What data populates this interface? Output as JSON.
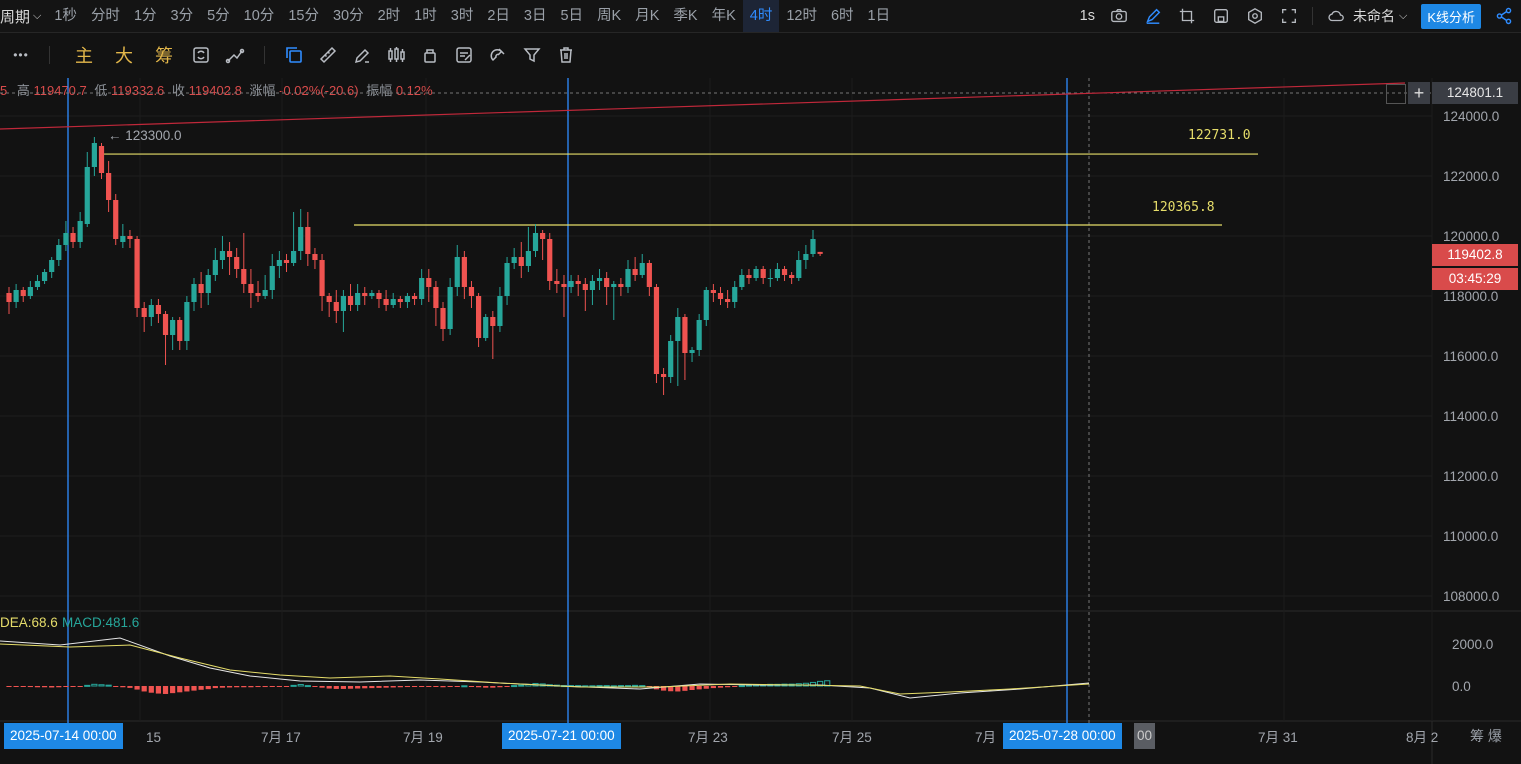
{
  "toolbar": {
    "period_label": "周期",
    "timeframes": [
      "1秒",
      "分时",
      "1分",
      "3分",
      "5分",
      "10分",
      "15分",
      "30分",
      "2时",
      "1时",
      "3时",
      "2日",
      "3日",
      "5日",
      "周K",
      "月K",
      "季K",
      "年K",
      "4时",
      "12时",
      "6时",
      "1日"
    ],
    "active_timeframe": "4时",
    "speed": "1s",
    "layout_name": "未命名",
    "kline_button": "K线分析"
  },
  "drawing_tools": {
    "more": "•••",
    "main_label": "主",
    "big_label": "大",
    "chip_label": "筹"
  },
  "ohlc": {
    "prefix": "5",
    "high_label": "高",
    "high": "119470.7",
    "low_label": "低",
    "low": "119332.6",
    "close_label": "收",
    "close": "119402.8",
    "change_label": "涨幅",
    "change": "-0.02%(-20.6)",
    "amp_label": "振幅",
    "amp": "0.12%"
  },
  "price_axis": {
    "ticks": [
      "124000.0",
      "122000.0",
      "120000.0",
      "118000.0",
      "116000.0",
      "114000.0",
      "112000.0",
      "110000.0",
      "108000.0"
    ],
    "crosshair_price": "124801.1",
    "last_price": "119402.8",
    "countdown": "03:45:29"
  },
  "macd_axis": {
    "ticks": [
      "2000.0",
      "0.0"
    ]
  },
  "macd_legend": {
    "dea": "DEA:68.6",
    "macd": "MACD:481.6"
  },
  "annotations": {
    "high_marker": "← 123300.0",
    "line1": "122731.0",
    "line2": "120365.8"
  },
  "date_axis": {
    "labels": [
      "15",
      "7月 17",
      "7月 19",
      "7月 23",
      "7月 25",
      "7月 31",
      "8月 2"
    ],
    "highlight_boxes": [
      "2025-07-14 00:00",
      "2025-07-21 00:00",
      "2025-07-28 00:00"
    ],
    "partial": "7月",
    "partial2": "00"
  },
  "bottom_right": "筹  爆",
  "colors": {
    "up": "#26a69a",
    "down": "#ef5350",
    "accent": "#2f8cff",
    "level": "#e6dd6a"
  },
  "chart_data": {
    "type": "candlestick",
    "ylim": [
      107000,
      125300
    ],
    "candles": [
      [
        118100,
        117800,
        118300,
        117400
      ],
      [
        117800,
        118200,
        118400,
        117600
      ],
      [
        118200,
        118000,
        118300,
        117800
      ],
      [
        118000,
        118300,
        118500,
        117900
      ],
      [
        118300,
        118500,
        118700,
        118200
      ],
      [
        118500,
        118800,
        118900,
        118400
      ],
      [
        118800,
        119200,
        119300,
        118600
      ],
      [
        119200,
        119700,
        119900,
        119000
      ],
      [
        119700,
        120100,
        120500,
        119500
      ],
      [
        120100,
        119800,
        120300,
        119600
      ],
      [
        119800,
        120500,
        120800,
        119600
      ],
      [
        120400,
        122300,
        122800,
        120300
      ],
      [
        122300,
        123100,
        123300,
        122000
      ],
      [
        123000,
        122100,
        123100,
        121900
      ],
      [
        122100,
        121200,
        122500,
        120800
      ],
      [
        121200,
        119900,
        121400,
        119700
      ],
      [
        119800,
        120000,
        120400,
        119600
      ],
      [
        120000,
        119900,
        120200,
        119600
      ],
      [
        119900,
        117600,
        120000,
        117300
      ],
      [
        117600,
        117300,
        117800,
        116800
      ],
      [
        117300,
        117700,
        117900,
        117000
      ],
      [
        117700,
        117400,
        117900,
        117100
      ],
      [
        117400,
        116700,
        117500,
        115700
      ],
      [
        116700,
        117200,
        117300,
        116200
      ],
      [
        117200,
        116500,
        117300,
        116200
      ],
      [
        116500,
        117800,
        118000,
        116200
      ],
      [
        117800,
        118400,
        118600,
        117500
      ],
      [
        118400,
        118100,
        118800,
        117600
      ],
      [
        118100,
        118700,
        118900,
        117700
      ],
      [
        118700,
        119200,
        119600,
        118500
      ],
      [
        119200,
        119500,
        120000,
        118900
      ],
      [
        119500,
        119300,
        119800,
        118700
      ],
      [
        119300,
        118900,
        119600,
        118600
      ],
      [
        118900,
        118400,
        120100,
        118100
      ],
      [
        118400,
        118100,
        118900,
        117600
      ],
      [
        118100,
        118000,
        118500,
        117800
      ],
      [
        118000,
        118200,
        118700,
        117900
      ],
      [
        118200,
        119000,
        119400,
        117900
      ],
      [
        119000,
        119200,
        119500,
        118600
      ],
      [
        119200,
        119100,
        119400,
        118800
      ],
      [
        119100,
        119500,
        120800,
        119000
      ],
      [
        119500,
        120300,
        120900,
        119200
      ],
      [
        120300,
        119400,
        120800,
        119000
      ],
      [
        119400,
        119200,
        119600,
        118900
      ],
      [
        119200,
        118000,
        119400,
        117500
      ],
      [
        118000,
        117800,
        118100,
        117300
      ],
      [
        117800,
        117500,
        118200,
        117100
      ],
      [
        117500,
        118000,
        118200,
        116800
      ],
      [
        118000,
        117700,
        118400,
        117500
      ],
      [
        117700,
        118100,
        118400,
        117500
      ],
      [
        118100,
        118000,
        118300,
        117700
      ],
      [
        118000,
        118100,
        118200,
        117900
      ],
      [
        118100,
        117900,
        118200,
        117600
      ],
      [
        117900,
        117700,
        118200,
        117500
      ],
      [
        117700,
        117900,
        118100,
        117600
      ],
      [
        117900,
        117800,
        118000,
        117600
      ],
      [
        117800,
        118000,
        118100,
        117600
      ],
      [
        118000,
        117900,
        118100,
        117700
      ],
      [
        117900,
        118600,
        118900,
        117700
      ],
      [
        118600,
        118300,
        118900,
        117800
      ],
      [
        118300,
        117600,
        118500,
        117000
      ],
      [
        117600,
        116900,
        117800,
        116500
      ],
      [
        116900,
        118300,
        118600,
        116700
      ],
      [
        118300,
        119300,
        119700,
        118000
      ],
      [
        119300,
        118300,
        119500,
        117900
      ],
      [
        118300,
        118000,
        118500,
        117600
      ],
      [
        118000,
        116600,
        118100,
        116300
      ],
      [
        116600,
        117300,
        117400,
        116500
      ],
      [
        117300,
        117000,
        117500,
        115900
      ],
      [
        117000,
        118000,
        118300,
        116800
      ],
      [
        118000,
        119100,
        119300,
        117700
      ],
      [
        119100,
        119300,
        119600,
        118900
      ],
      [
        119300,
        119000,
        119800,
        118600
      ],
      [
        119000,
        119500,
        120300,
        118800
      ],
      [
        119500,
        120100,
        120400,
        119300
      ],
      [
        120100,
        119900,
        120200,
        119200
      ],
      [
        119900,
        118500,
        120100,
        118200
      ],
      [
        118500,
        118400,
        118900,
        118100
      ],
      [
        118400,
        118300,
        118700,
        117300
      ],
      [
        118300,
        118500,
        118700,
        118100
      ],
      [
        118500,
        118400,
        118700,
        118000
      ],
      [
        118400,
        118200,
        118600,
        117500
      ],
      [
        118200,
        118500,
        118700,
        117700
      ],
      [
        118500,
        118600,
        118900,
        118200
      ],
      [
        118600,
        118300,
        118800,
        117700
      ],
      [
        118300,
        118400,
        118500,
        117200
      ],
      [
        118400,
        118300,
        118600,
        118000
      ],
      [
        118300,
        118900,
        119200,
        118100
      ],
      [
        118900,
        118700,
        119300,
        118500
      ],
      [
        118700,
        119100,
        119400,
        118600
      ],
      [
        119100,
        118300,
        119200,
        118000
      ],
      [
        118300,
        115400,
        118400,
        115100
      ],
      [
        115400,
        115300,
        115600,
        114700
      ],
      [
        115300,
        116500,
        116700,
        115100
      ],
      [
        116500,
        117300,
        117600,
        115000
      ],
      [
        117300,
        116100,
        117400,
        115200
      ],
      [
        116100,
        116200,
        116300,
        115800
      ],
      [
        116200,
        117200,
        117400,
        116000
      ],
      [
        117200,
        118200,
        118300,
        117000
      ],
      [
        118200,
        118100,
        118400,
        117800
      ],
      [
        118100,
        117900,
        118300,
        117700
      ],
      [
        117900,
        117800,
        118200,
        117600
      ],
      [
        117800,
        118300,
        118500,
        117600
      ],
      [
        118300,
        118700,
        118900,
        118200
      ],
      [
        118700,
        118600,
        118900,
        118400
      ],
      [
        118600,
        118900,
        119000,
        118500
      ],
      [
        118900,
        118600,
        119000,
        118400
      ],
      [
        118600,
        118600,
        118900,
        118300
      ],
      [
        118600,
        118900,
        119100,
        118500
      ],
      [
        118900,
        118700,
        119000,
        118500
      ],
      [
        118700,
        118600,
        118800,
        118400
      ],
      [
        118600,
        119200,
        119500,
        118500
      ],
      [
        119200,
        119400,
        119700,
        118900
      ],
      [
        119400,
        119900,
        120200,
        119300
      ],
      [
        119470,
        119403,
        119471,
        119333
      ]
    ],
    "levels": [
      122731.0,
      120365.8
    ],
    "macd_hist": [
      -20,
      -30,
      -40,
      -50,
      -60,
      -60,
      -70,
      -60,
      -40,
      -40,
      -30,
      30,
      80,
      60,
      40,
      -30,
      -60,
      -90,
      -170,
      -260,
      -320,
      -360,
      -380,
      -340,
      -300,
      -260,
      -220,
      -180,
      -150,
      -100,
      -80,
      -70,
      -60,
      -60,
      -60,
      -50,
      -50,
      -40,
      -30,
      -20,
      30,
      70,
      20,
      -20,
      -80,
      -120,
      -140,
      -140,
      -130,
      -120,
      -110,
      -100,
      -90,
      -80,
      -70,
      -60,
      -50,
      -40,
      -20,
      -30,
      -40,
      -60,
      -40,
      -10,
      10,
      -20,
      -60,
      -80,
      -80,
      -60,
      -20,
      20,
      40,
      80,
      120,
      100,
      60,
      40,
      20,
      20,
      20,
      10,
      10,
      20,
      20,
      10,
      20,
      20,
      30,
      20,
      -40,
      -160,
      -220,
      -250,
      -260,
      -230,
      -190,
      -160,
      -130,
      -100,
      -80,
      -60,
      -30,
      20,
      40,
      60,
      70,
      80,
      80,
      90,
      90,
      110,
      130,
      170,
      220,
      250
    ]
  }
}
